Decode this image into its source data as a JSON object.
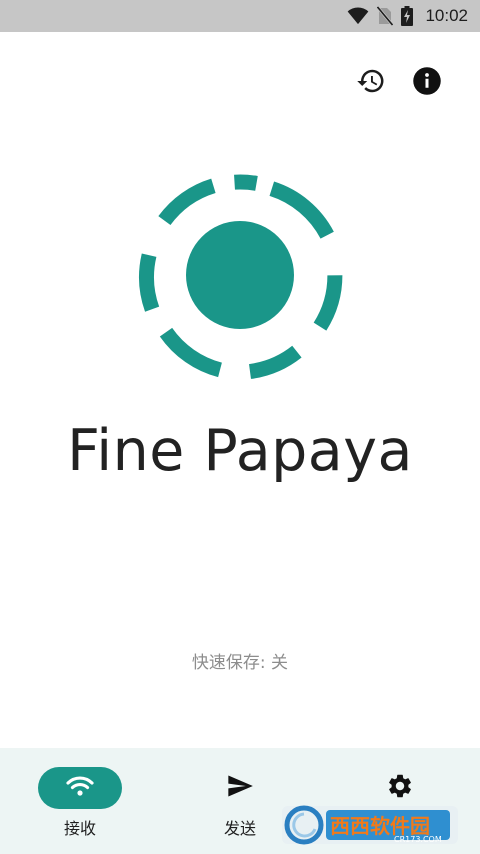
{
  "status_bar": {
    "time": "10:02",
    "icons": [
      "wifi-signal-icon",
      "no-sim-icon",
      "battery-charging-icon"
    ]
  },
  "top_actions": {
    "icons": [
      "history-icon",
      "info-icon"
    ]
  },
  "app": {
    "name": "Fine Papaya",
    "quick_save": "快速保存: 关",
    "accent_color": "#1a9689"
  },
  "bottom_nav": {
    "items": [
      {
        "label": "接收",
        "icon": "wifi-icon",
        "selected": true
      },
      {
        "label": "发送",
        "icon": "send-icon",
        "selected": false
      },
      {
        "label": "",
        "icon": "gear-icon",
        "selected": false
      }
    ]
  },
  "watermark": {
    "text": "西西软件园",
    "subtext": "CR173.COM"
  }
}
